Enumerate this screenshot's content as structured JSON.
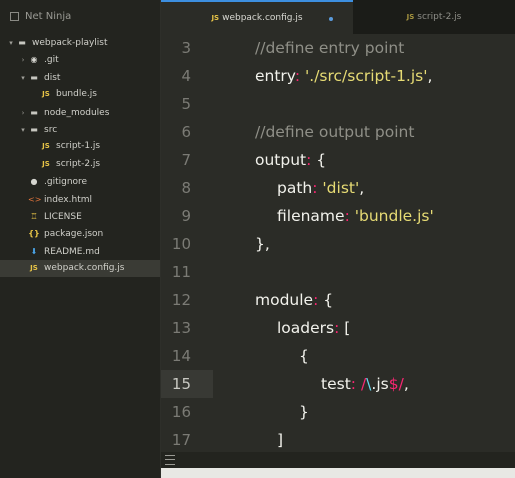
{
  "sidebar": {
    "title": "Net Ninja",
    "tree": [
      {
        "label": "webpack-playlist",
        "icon": "folder-open-icon",
        "indent": 0,
        "arrow": "▾",
        "type": "folder"
      },
      {
        "label": ".git",
        "icon": "git-icon",
        "indent": 1,
        "arrow": "›",
        "type": "git"
      },
      {
        "label": "dist",
        "icon": "folder-open-icon",
        "indent": 1,
        "arrow": "▾",
        "type": "folder"
      },
      {
        "label": "bundle.js",
        "icon": "js-file-icon",
        "indent": 2,
        "arrow": "",
        "type": "js"
      },
      {
        "label": "node_modules",
        "icon": "folder-closed-icon",
        "indent": 1,
        "arrow": "›",
        "type": "folder"
      },
      {
        "label": "src",
        "icon": "folder-open-icon",
        "indent": 1,
        "arrow": "▾",
        "type": "folder"
      },
      {
        "label": "script-1.js",
        "icon": "js-file-icon",
        "indent": 2,
        "arrow": "",
        "type": "js"
      },
      {
        "label": "script-2.js",
        "icon": "js-file-icon",
        "indent": 2,
        "arrow": "",
        "type": "js"
      },
      {
        "label": ".gitignore",
        "icon": "github-icon",
        "indent": 1,
        "arrow": "",
        "type": "git"
      },
      {
        "label": "index.html",
        "icon": "html-file-icon",
        "indent": 1,
        "arrow": "",
        "type": "html"
      },
      {
        "label": "LICENSE",
        "icon": "license-icon",
        "indent": 1,
        "arrow": "",
        "type": "lic"
      },
      {
        "label": "package.json",
        "icon": "json-file-icon",
        "indent": 1,
        "arrow": "",
        "type": "json"
      },
      {
        "label": "README.md",
        "icon": "markdown-file-icon",
        "indent": 1,
        "arrow": "",
        "type": "md"
      },
      {
        "label": "webpack.config.js",
        "icon": "js-file-icon",
        "indent": 1,
        "arrow": "",
        "type": "js",
        "active": true
      }
    ]
  },
  "tabs": [
    {
      "label": "webpack.config.js",
      "badge": "JS",
      "modified": true,
      "active": true
    },
    {
      "label": "script-2.js",
      "badge": "JS",
      "modified": false,
      "active": false
    }
  ],
  "editor": {
    "current_line": 15,
    "lines": [
      {
        "num": "3",
        "tokens": [
          [
            "comment",
            "//define entry point"
          ]
        ],
        "indent": 0
      },
      {
        "num": "4",
        "tokens": [
          [
            "key",
            "entry"
          ],
          [
            "punc",
            ": "
          ],
          [
            "str",
            "'./src/script-1.js'"
          ],
          [
            "white",
            ","
          ]
        ],
        "indent": 0
      },
      {
        "num": "5",
        "tokens": [],
        "indent": 0
      },
      {
        "num": "6",
        "tokens": [
          [
            "comment",
            "//define output point"
          ]
        ],
        "indent": 0
      },
      {
        "num": "7",
        "tokens": [
          [
            "key",
            "output"
          ],
          [
            "punc",
            ": "
          ],
          [
            "white",
            "{"
          ]
        ],
        "indent": 0
      },
      {
        "num": "8",
        "tokens": [
          [
            "key",
            "path"
          ],
          [
            "punc",
            ": "
          ],
          [
            "str",
            "'dist'"
          ],
          [
            "white",
            ","
          ]
        ],
        "indent": 1
      },
      {
        "num": "9",
        "tokens": [
          [
            "key",
            "filename"
          ],
          [
            "punc",
            ": "
          ],
          [
            "str",
            "'bundle.js'"
          ]
        ],
        "indent": 1
      },
      {
        "num": "10",
        "tokens": [
          [
            "white",
            "},"
          ]
        ],
        "indent": 0
      },
      {
        "num": "11",
        "tokens": [],
        "indent": 0
      },
      {
        "num": "12",
        "tokens": [
          [
            "key",
            "module"
          ],
          [
            "punc",
            ": "
          ],
          [
            "white",
            "{"
          ]
        ],
        "indent": 0
      },
      {
        "num": "13",
        "tokens": [
          [
            "key",
            "loaders"
          ],
          [
            "punc",
            ": "
          ],
          [
            "white",
            "["
          ]
        ],
        "indent": 1
      },
      {
        "num": "14",
        "tokens": [
          [
            "white",
            "{"
          ]
        ],
        "indent": 2
      },
      {
        "num": "15",
        "tokens": [
          [
            "key",
            "test"
          ],
          [
            "punc",
            ": "
          ],
          [
            "strslash",
            "/"
          ],
          [
            "regex",
            "\\"
          ],
          [
            "white",
            ".js"
          ],
          [
            "strslash",
            "$/"
          ],
          [
            "white",
            ","
          ]
        ],
        "indent": 3
      },
      {
        "num": "16",
        "tokens": [
          [
            "white",
            "}"
          ]
        ],
        "indent": 2
      },
      {
        "num": "17",
        "tokens": [
          [
            "white",
            "]"
          ]
        ],
        "indent": 1
      }
    ]
  },
  "statusbar": {
    "icon": "menu-icon"
  },
  "colors": {
    "accent": "#3d8fe0",
    "string": "#e6db74",
    "keyword_punc": "#f92672",
    "comment": "#8f8f87"
  }
}
